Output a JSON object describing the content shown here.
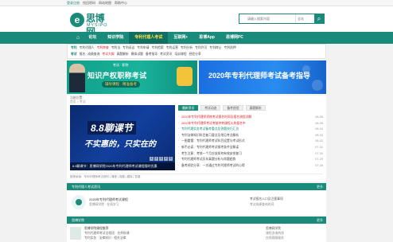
{
  "topbar": {
    "links": [
      "登录注册",
      "找回密码",
      "网站地图",
      "帮助中心"
    ]
  },
  "logo": {
    "mark": "e",
    "cn": "思博网",
    "en": "MYSIPO"
  },
  "search": {
    "placeholder": "请输入搜索内容",
    "scope": "全站",
    "button_icon": "search-icon"
  },
  "nav": {
    "items": [
      {
        "label": "⌂",
        "icon": "home-icon"
      },
      {
        "label": "论坛"
      },
      {
        "label": "知识学院"
      },
      {
        "label": "专利代理人考试",
        "active": true
      },
      {
        "label": "互联网+"
      },
      {
        "label": "思博App"
      },
      {
        "label": "思博网PC"
      }
    ]
  },
  "subnav": {
    "row1": [
      {
        "text": "专利",
        "tag": true
      },
      {
        "text": "专利代理人"
      },
      {
        "text": "专利审查",
        "hl": true
      },
      {
        "text": "专利法"
      },
      {
        "text": "专利诉讼"
      },
      {
        "text": "专利申请"
      },
      {
        "text": "专利检索"
      },
      {
        "text": "专利运营"
      },
      {
        "text": "专利分析"
      },
      {
        "text": "专利许可"
      },
      {
        "text": "专利转让"
      },
      {
        "text": "专利质押"
      }
    ],
    "row2": [
      {
        "text": "考试",
        "tag": true
      },
      {
        "text": "报名"
      },
      {
        "text": "成绩查询"
      },
      {
        "text": "考试大纲",
        "hl": true
      },
      {
        "text": "真题解析"
      },
      {
        "text": "模拟试题"
      },
      {
        "text": "备考指导"
      },
      {
        "text": "考试资讯"
      },
      {
        "text": "培训课程"
      },
      {
        "text": "经验分享"
      }
    ]
  },
  "banner_left": {
    "small": "考试 · 职称",
    "title": "知识产权职称考试",
    "sub": "辅导课程 · 精准备考"
  },
  "banner_right": {
    "title": "2020年专利代理师考试备考指导"
  },
  "main": {
    "crumb": "当前位置：",
    "crumb2": "首页 > 考试",
    "slider": {
      "t1": "8.8聊课节",
      "t2": "不实惠的，只实在的",
      "caption": "8.8聊课节：思博网学院2020年专利代理师考试课程限时优惠",
      "pages": [
        "1",
        "2",
        "3",
        "4",
        "5"
      ]
    },
    "tabs": [
      {
        "label": "最新资讯",
        "active": true
      },
      {
        "label": "考试动态"
      },
      {
        "label": "备考经验"
      },
      {
        "label": "真题解析"
      }
    ],
    "news": [
      {
        "text": "2020年专利代理师资格考试报名时间及报名流程详解",
        "style": "red",
        "date": "08-06"
      },
      {
        "text": "2020年专利代理师考试考前冲刺课程火热报名中",
        "style": "red",
        "date": "08-05"
      },
      {
        "text": "专利代理实务考试备考重点及答题技巧汇总",
        "style": "green",
        "date": "08-04"
      },
      {
        "text": "专利法律知识科目复习要点及常见考点解析",
        "style": "",
        "date": "08-03"
      },
      {
        "text": "一图看懂：专利代理师考试科目设置与考试形式",
        "style": "",
        "date": "08-02"
      },
      {
        "text": "新手必读：专利代理师考试报考条件全解读",
        "style": "",
        "date": "07-31"
      },
      {
        "text": "考生注意：考前一个月应该如何有效安排复习",
        "style": "",
        "date": "07-30"
      },
      {
        "text": "专利代理师考试历年真题分析与命题趋势",
        "style": "",
        "date": "07-29"
      },
      {
        "text": "备考经验分享：一次通过专利代理师考试的心得",
        "style": "",
        "date": "07-28"
      }
    ],
    "strip": "推荐阅读：专利代理师考试资料 | 课程 | 真题 | 模拟 | 答疑"
  },
  "section1": {
    "title": "专利代理人考试资讯",
    "more": "更多",
    "l1": "2020年专利代理师考试课程",
    "l2": "思博网学院 · 在线学习",
    "r1": "考试报名入口及注意事项",
    "r2": "考试成绩查询时间"
  },
  "section2": {
    "title": "思博学院",
    "more": "更多",
    "l1": "思博学院课程推荐",
    "l2": "专利代理师考试全程班 · 名师授课",
    "l3": "专利实务 · 法律知识 · 相关法律",
    "r1": "思博网学院",
    "r2": "课程咨询热线",
    "r3": "在线客服服务"
  },
  "colors": {
    "accent": "#1a8a7a",
    "highlight": "#d9232b",
    "nav_active_text": "#ffe14a"
  }
}
